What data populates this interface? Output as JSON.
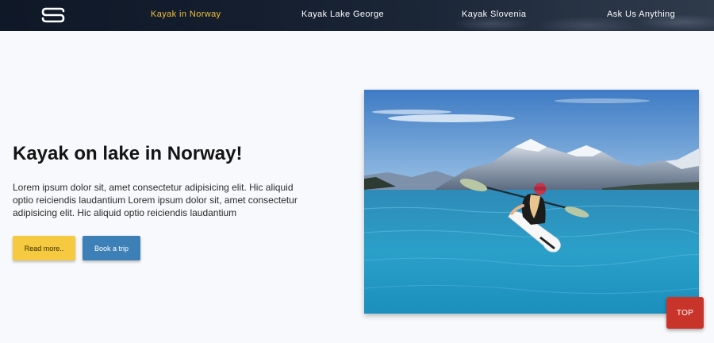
{
  "nav": {
    "logo_icon": "brand-swirl-logo",
    "items": [
      {
        "label": "Kayak in Norway",
        "active": true
      },
      {
        "label": "Kayak Lake George",
        "active": false
      },
      {
        "label": "Kayak Slovenia",
        "active": false
      },
      {
        "label": "Ask Us Anything",
        "active": false
      }
    ]
  },
  "hero": {
    "title": "Kayak on lake in Norway!",
    "text": "Lorem ipsum dolor sit, amet consectetur adipisicing elit. Hic aliquid optio reiciendis laudantium Lorem ipsum dolor sit, amet consectetur adipisicing elit. Hic aliquid optio reiciendis laudantium",
    "read_more_label": "Read more..",
    "book_label": "Book a trip",
    "image_subject": "woman-kayaking-on-mountain-lake"
  },
  "back_to_top": {
    "label": "TOP"
  },
  "colors": {
    "nav_active": "#f2c13a",
    "read_button": "#f5c940",
    "book_button": "#3d80b8",
    "top_button": "#c8342a"
  }
}
